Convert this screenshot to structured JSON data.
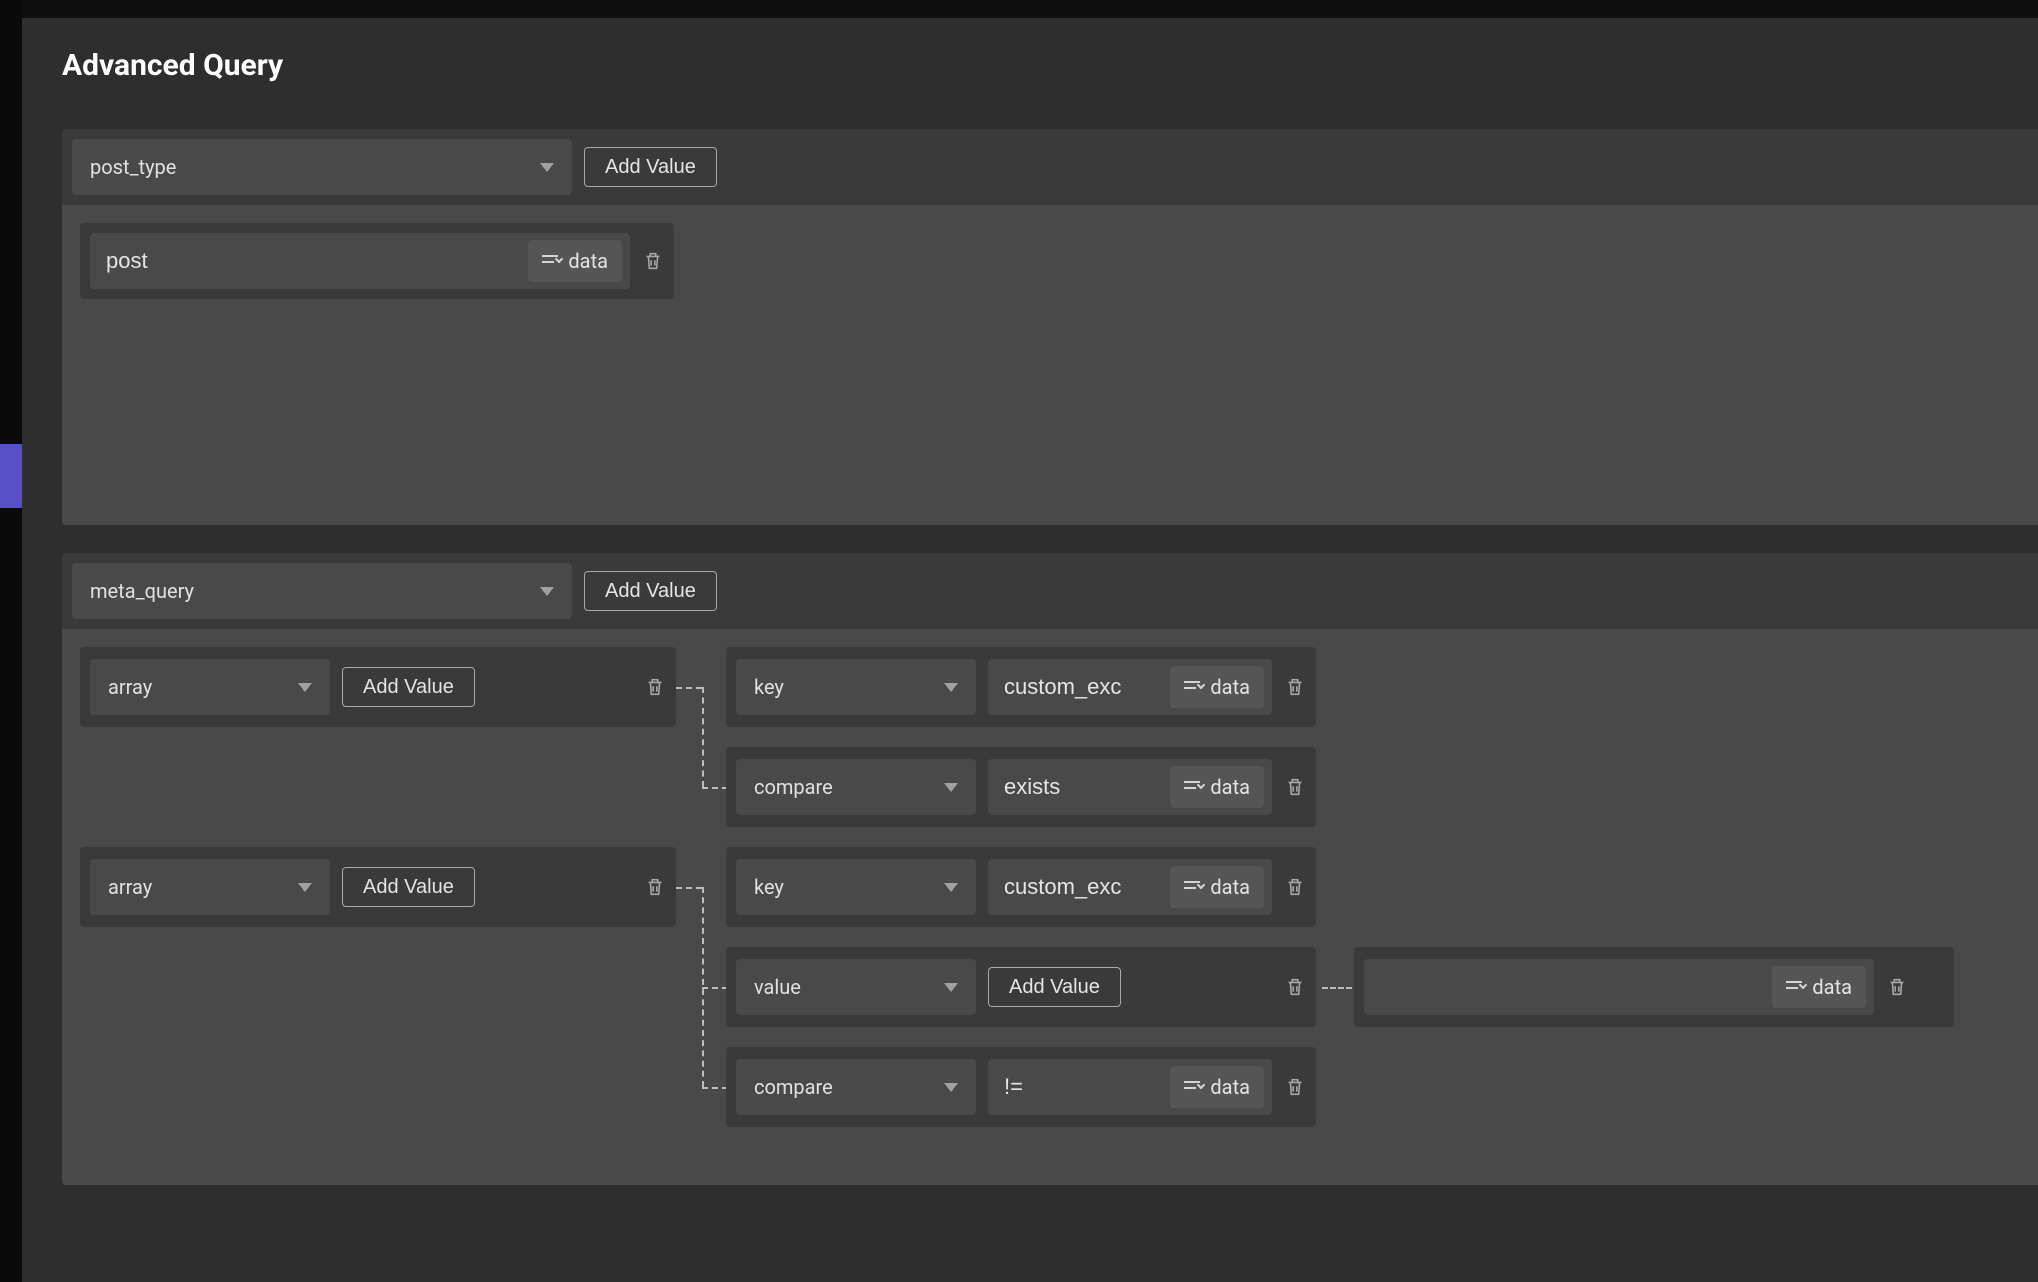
{
  "title": "Advanced Query",
  "labels": {
    "add_value": "Add Value",
    "data_chip": "data"
  },
  "sections": [
    {
      "param": "post_type",
      "rows": [
        {
          "value": "post"
        }
      ]
    },
    {
      "param": "meta_query",
      "arrays": [
        {
          "label": "array",
          "entries": [
            {
              "key": "key",
              "value": "custom_exc"
            },
            {
              "key": "compare",
              "value": "exists"
            }
          ]
        },
        {
          "label": "array",
          "entries": [
            {
              "key": "key",
              "value": "custom_exc"
            },
            {
              "key": "value",
              "value": "",
              "add_value": true,
              "extra": {
                "value": ""
              }
            },
            {
              "key": "compare",
              "value": "!="
            }
          ]
        }
      ]
    }
  ]
}
